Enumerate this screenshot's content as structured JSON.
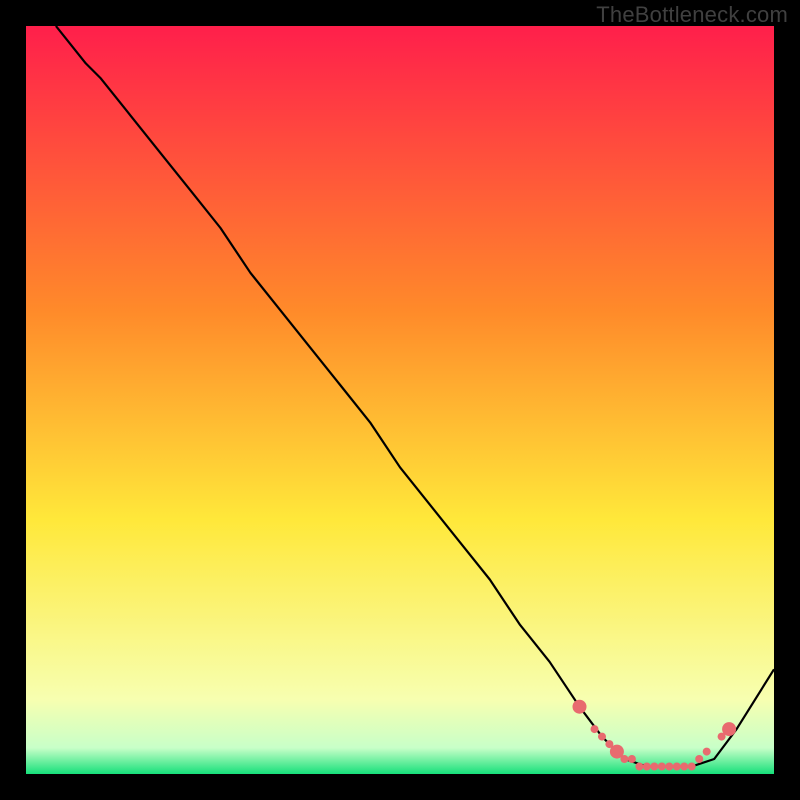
{
  "watermark": "TheBottleneck.com",
  "colors": {
    "bg": "#000000",
    "grad_top": "#ff1f4b",
    "grad_mid1": "#ff8a2a",
    "grad_mid2": "#ffe83a",
    "grad_low": "#f7ffb0",
    "grad_bottom": "#16e07a",
    "curve": "#000000",
    "marker": "#e86a6f"
  },
  "chart_data": {
    "type": "line",
    "title": "",
    "xlabel": "",
    "ylabel": "",
    "xlim": [
      0,
      100
    ],
    "ylim": [
      0,
      100
    ],
    "series": [
      {
        "name": "bottleneck-curve",
        "x": [
          4,
          8,
          10,
          14,
          18,
          22,
          26,
          30,
          34,
          38,
          42,
          46,
          50,
          54,
          58,
          62,
          66,
          70,
          74,
          77,
          80,
          83,
          86,
          89,
          92,
          95,
          100
        ],
        "y": [
          100,
          95,
          93,
          88,
          83,
          78,
          73,
          67,
          62,
          57,
          52,
          47,
          41,
          36,
          31,
          26,
          20,
          15,
          9,
          5,
          2,
          1,
          1,
          1,
          2,
          6,
          14
        ]
      }
    ],
    "markers": {
      "name": "highlight-dots",
      "x": [
        74,
        76,
        77,
        78,
        79,
        80,
        81,
        82,
        83,
        84,
        85,
        86,
        87,
        88,
        89,
        90,
        91,
        93,
        94
      ],
      "y": [
        9,
        6,
        5,
        4,
        3,
        2,
        2,
        1,
        1,
        1,
        1,
        1,
        1,
        1,
        1,
        2,
        3,
        5,
        6
      ],
      "r_small": 4,
      "r_big": 7,
      "big_indices": [
        0,
        4,
        18
      ]
    }
  }
}
